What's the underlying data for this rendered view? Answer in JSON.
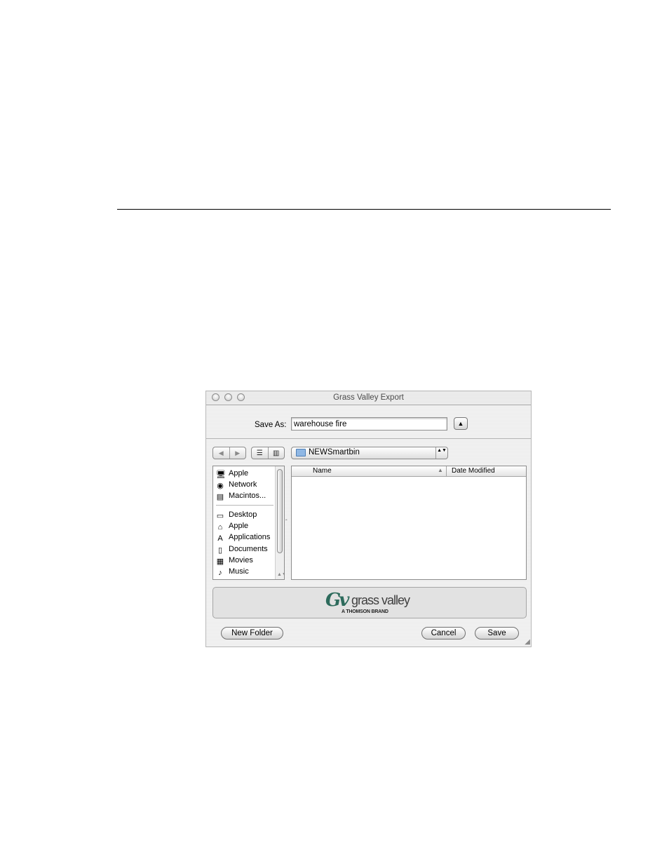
{
  "window": {
    "title": "Grass Valley Export",
    "save_as_label": "Save As:",
    "save_as_value": "warehouse fire",
    "expand_icon": "▲",
    "nav_back": "◀",
    "nav_forward": "▶",
    "view_list": "☰",
    "view_columns": "▥",
    "location": "NEWSmartbin",
    "location_arrows": "▲▼"
  },
  "sidebar": {
    "items": [
      {
        "label": "Apple",
        "icon": "computer-icon",
        "glyph": "🖥"
      },
      {
        "label": "Network",
        "icon": "network-globe-icon",
        "glyph": "◉"
      },
      {
        "label": "Macintos...",
        "icon": "hard-drive-icon",
        "glyph": "▤"
      },
      {
        "label": "Desktop",
        "icon": "desktop-icon",
        "glyph": "▭"
      },
      {
        "label": "Apple",
        "icon": "home-icon",
        "glyph": "⌂"
      },
      {
        "label": "Applications",
        "icon": "applications-icon",
        "glyph": "A"
      },
      {
        "label": "Documents",
        "icon": "documents-icon",
        "glyph": "▯"
      },
      {
        "label": "Movies",
        "icon": "movies-icon",
        "glyph": "▦"
      },
      {
        "label": "Music",
        "icon": "music-icon",
        "glyph": "♪"
      }
    ],
    "scroll_arrows": "▲▼"
  },
  "file_list": {
    "columns": [
      "Name",
      "Date Modified"
    ],
    "sort_indicator": "▲",
    "rows": []
  },
  "banner": {
    "logo_mark": "Gv",
    "logo_text": "grass valley",
    "logo_subtext": "A THOMSON BRAND"
  },
  "buttons": {
    "new_folder": "New Folder",
    "cancel": "Cancel",
    "save": "Save"
  },
  "colors": {
    "logo_green": "#2d6b5c",
    "window_bg": "#ececec"
  }
}
